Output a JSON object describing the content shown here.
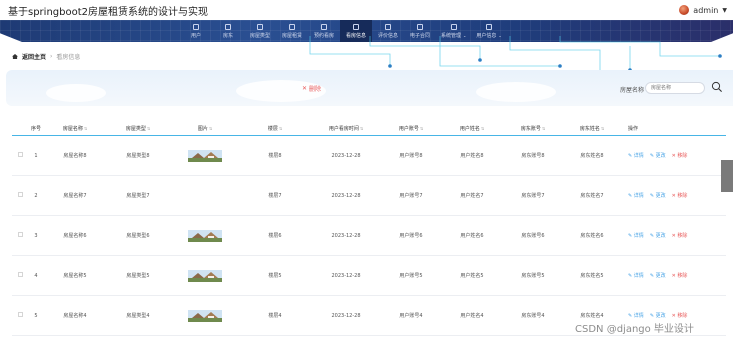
{
  "app": {
    "title": "基于springboot2房屋租赁系统的设计与实现"
  },
  "user": {
    "name": "admin"
  },
  "nav": [
    {
      "label": "用户",
      "icon": "shield-icon",
      "active": false
    },
    {
      "label": "房东",
      "icon": "grid-icon",
      "active": false
    },
    {
      "label": "房屋类型",
      "icon": "grid-icon",
      "active": false
    },
    {
      "label": "房屋租赁",
      "icon": "grid-icon",
      "active": false
    },
    {
      "label": "预约看房",
      "icon": "grid-icon",
      "active": false
    },
    {
      "label": "看房信息",
      "icon": "grid-icon",
      "active": true
    },
    {
      "label": "评价信息",
      "icon": "person-icon",
      "active": false
    },
    {
      "label": "电子合同",
      "icon": "grid-icon",
      "active": false
    },
    {
      "label": "系统管理",
      "icon": "chat-icon",
      "active": false,
      "sub": "⌄"
    },
    {
      "label": "用户信息",
      "icon": "card-icon",
      "active": false,
      "sub": "⌄"
    }
  ],
  "breadcrumb": {
    "home": "返回主页",
    "separator": "›",
    "current": "看房信息"
  },
  "toolbar": {
    "delete_label": "删除",
    "search_label": "房屋名称",
    "search_placeholder": "房屋名称"
  },
  "table": {
    "headers": {
      "index": "序号",
      "name": "房屋名称",
      "type": "房屋类型",
      "image": "图片",
      "floor": "楼层",
      "date": "用户看房时间",
      "account": "用户账号",
      "username": "用户姓名",
      "landlord_account": "房东账号",
      "landlord_name": "房东姓名",
      "ops": "操作"
    },
    "ops": {
      "detail": "详情",
      "edit": "更改",
      "delete": "移除"
    },
    "rows": [
      {
        "index": "1",
        "name": "房屋名称8",
        "type": "房屋类型8",
        "image": "house-photo",
        "floor": "楼层8",
        "date": "2023-12-28",
        "account": "用户账号8",
        "username": "用户姓名8",
        "landlord_account": "房东账号8",
        "landlord_name": "房东姓名8"
      },
      {
        "index": "2",
        "name": "房屋名称7",
        "type": "房屋类型7",
        "image": "",
        "floor": "楼层7",
        "date": "2023-12-28",
        "account": "用户账号7",
        "username": "用户姓名7",
        "landlord_account": "房东账号7",
        "landlord_name": "房东姓名7"
      },
      {
        "index": "3",
        "name": "房屋名称6",
        "type": "房屋类型6",
        "image": "house-photo",
        "floor": "楼层6",
        "date": "2023-12-28",
        "account": "用户账号6",
        "username": "用户姓名6",
        "landlord_account": "房东账号6",
        "landlord_name": "房东姓名6"
      },
      {
        "index": "4",
        "name": "房屋名称5",
        "type": "房屋类型5",
        "image": "house-photo",
        "floor": "楼层5",
        "date": "2023-12-28",
        "account": "用户账号5",
        "username": "用户姓名5",
        "landlord_account": "房东账号5",
        "landlord_name": "房东姓名5"
      },
      {
        "index": "5",
        "name": "房屋名称4",
        "type": "房屋类型4",
        "image": "house-photo",
        "floor": "楼层4",
        "date": "2023-12-28",
        "account": "用户账号4",
        "username": "用户姓名4",
        "landlord_account": "房东账号4",
        "landlord_name": "房东姓名4"
      }
    ]
  },
  "watermark": "CSDN @django 毕业设计",
  "colors": {
    "nav": "#2a4f92",
    "nav_active": "#162b5a",
    "accent": "#47b5e6",
    "danger": "#e85a5a"
  }
}
